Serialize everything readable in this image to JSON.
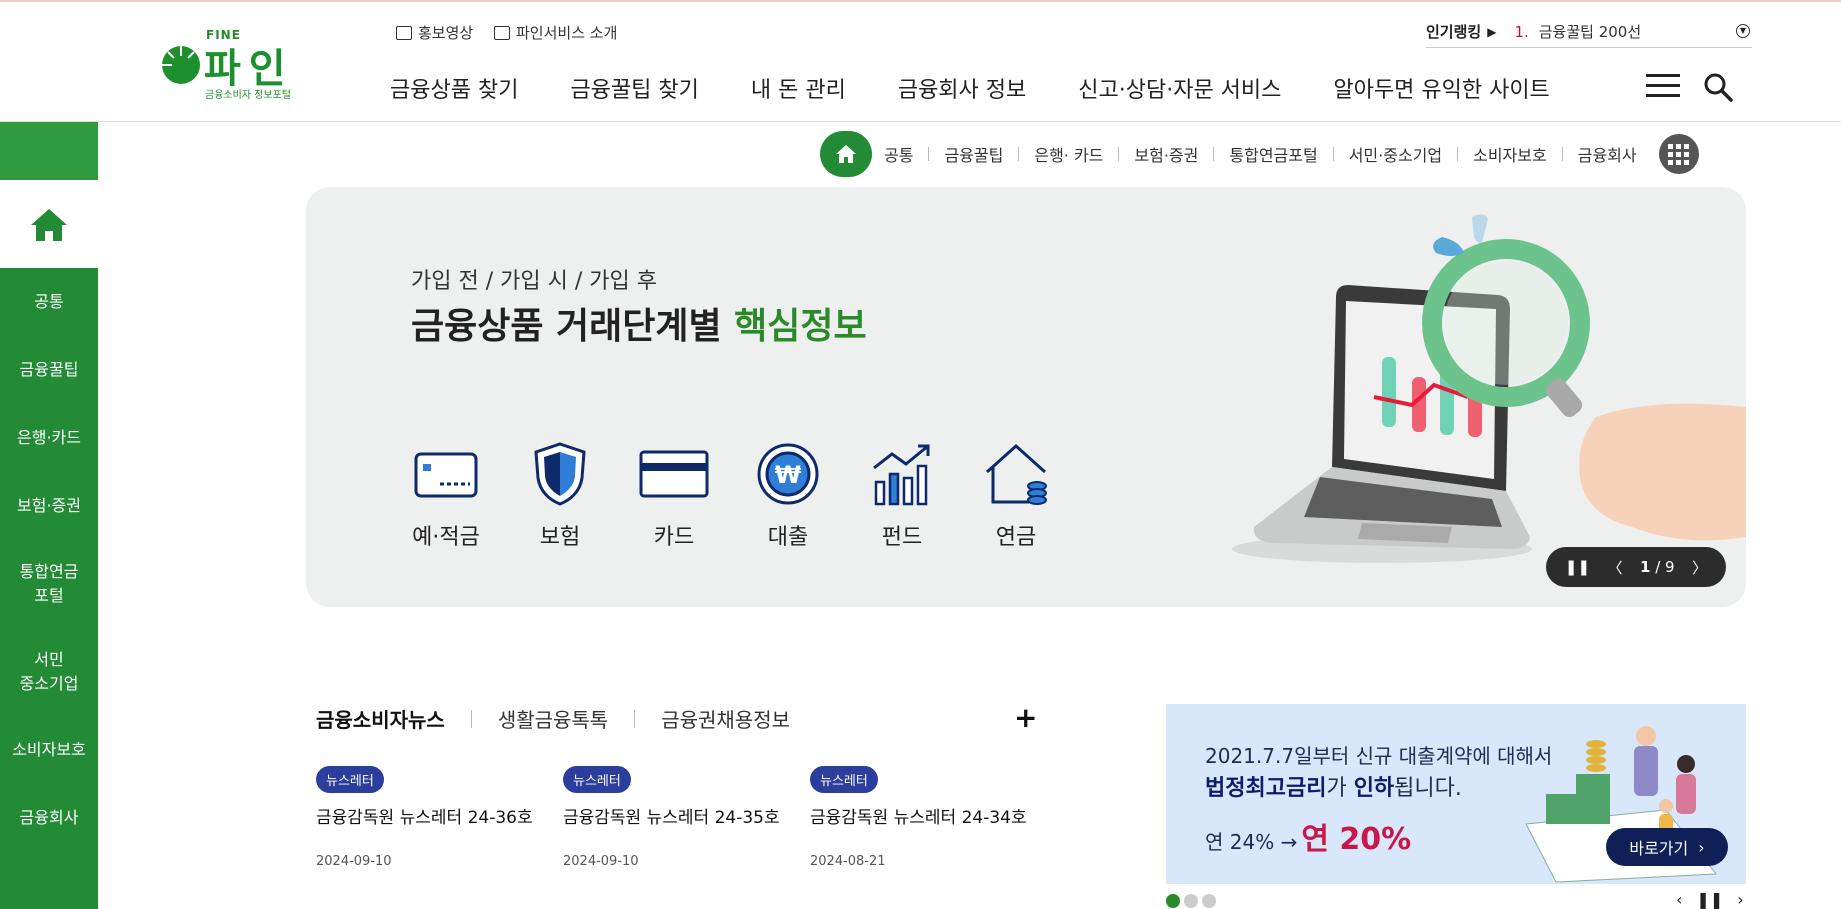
{
  "header": {
    "logo": {
      "fine": "FINE",
      "name": "파인",
      "sub": "금융소비자 정보포털"
    },
    "util_links": [
      "홍보영상",
      "파인서비스 소개"
    ],
    "gnb": [
      "금융상품 찾기",
      "금융꿀팁 찾기",
      "내 돈 관리",
      "금융회사 정보",
      "신고·상담·자문 서비스",
      "알아두면 유익한 사이트"
    ],
    "ranking": {
      "label": "인기랭킹",
      "arrow": "▶",
      "number": "1.",
      "text": "금융꿀팁 200선"
    }
  },
  "sidebar": {
    "items": [
      "공통",
      "금융꿀팁",
      "은행·카드",
      "보험·증권",
      "통합연금\n포털",
      "서민\n중소기업",
      "소비자보호",
      "금융회사"
    ]
  },
  "quicknav": {
    "items": [
      "공통",
      "금융꿀팁",
      "은행· 카드",
      "보험·증권",
      "통합연금포털",
      "서민·중소기업",
      "소비자보호",
      "금융회사"
    ]
  },
  "banner": {
    "kicker": "가입 전 / 가입 시 / 가입 후",
    "title_main": "금융상품 거래단계별 ",
    "title_highlight": "핵심정보",
    "categories": [
      "예·적금",
      "보험",
      "카드",
      "대출",
      "펀드",
      "연금"
    ],
    "page_current": "1",
    "page_total": "/ 9"
  },
  "news": {
    "tabs": [
      "금융소비자뉴스",
      "생활금융톡톡",
      "금융권채용정보"
    ],
    "plus": "+",
    "items": [
      {
        "badge": "뉴스레터",
        "title": "금융감독원 뉴스레터 24-36호",
        "date": "2024-09-10"
      },
      {
        "badge": "뉴스레터",
        "title": "금융감독원 뉴스레터 24-35호",
        "date": "2024-09-10"
      },
      {
        "badge": "뉴스레터",
        "title": "금융감독원 뉴스레터 24-34호",
        "date": "2024-08-21"
      }
    ]
  },
  "ad": {
    "line1": "2021.7.7일부터 신규 대출계약에 대해서",
    "line2_bold1": "법정최고금리",
    "line2_mid": "가 ",
    "line2_bold2": "인하",
    "line2_end": "됩니다.",
    "line3_from": "연 24% →",
    "line3_to": "연 20%",
    "button": "바로가기"
  },
  "colors": {
    "brand_green": "#238a35",
    "highlight_green": "#2a8a2a",
    "ad_bg": "#d8e8fa",
    "accent_red": "#c81748"
  }
}
